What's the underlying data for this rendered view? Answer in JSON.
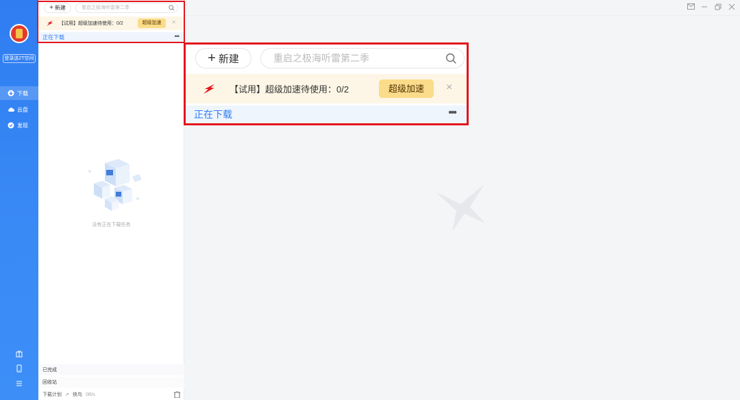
{
  "sidebar": {
    "promo_label": "登录送2T空间",
    "items": [
      {
        "label": "下载",
        "icon": "download-icon",
        "active": true
      },
      {
        "label": "云盘",
        "icon": "cloud-icon",
        "active": false
      },
      {
        "label": "发现",
        "icon": "discover-icon",
        "active": false
      }
    ],
    "bottom_icons": [
      "gift-box-icon",
      "phone-icon",
      "menu-icon"
    ]
  },
  "toolbar": {
    "new_label": "新建",
    "search_placeholder": "重启之极海听雷第二季"
  },
  "trial_banner": {
    "text": "【试用】超级加速待使用：0/2",
    "button_label": "超级加速",
    "close_label": "×"
  },
  "section": {
    "title": "正在下载",
    "more_label": "•••"
  },
  "empty_state": {
    "text": "没有正在下载任务"
  },
  "footer": {
    "completed_label": "已完成",
    "recycle_label": "回收站",
    "plan_label": "下载计划",
    "mode_label": "快鸟",
    "speed": "0B/s"
  },
  "window_controls": [
    "mail-icon",
    "minimize-icon",
    "restore-icon",
    "close-icon"
  ],
  "colors": {
    "accent": "#2f7df1",
    "highlight_border": "#e3141d",
    "trial_bg": "#fdf6e6",
    "badge_bg": "#fbdc8a"
  }
}
